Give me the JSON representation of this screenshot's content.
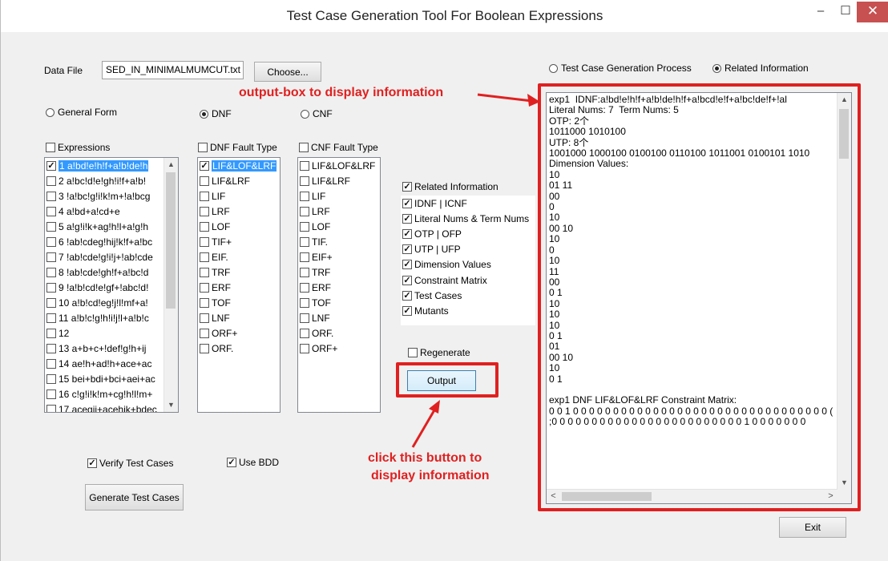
{
  "window": {
    "title": "Test Case Generation Tool  For Boolean Expressions",
    "minimize": "–",
    "maximize": "☐",
    "close": "✕"
  },
  "data_file": {
    "label": "Data File",
    "value": "SED_IN_MINIMALMUMCUT.txt",
    "choose": "Choose..."
  },
  "view_mode": {
    "process": "Test Case Generation Process",
    "related": "Related Information",
    "selected": "related"
  },
  "form": {
    "general": "General Form",
    "dnf": "DNF",
    "cnf": "CNF",
    "selected": "dnf"
  },
  "expressions": {
    "header": "Expressions",
    "items": [
      {
        "label": "1 a!bd!e!h!f+a!b!de!h",
        "checked": true,
        "selected": true
      },
      {
        "label": "2 a!bc!d!e!gh!i!f+a!b!",
        "checked": false
      },
      {
        "label": "3 !a!bc!g!i!k!m+!a!bcg",
        "checked": false
      },
      {
        "label": "4 a!bd+a!cd+e",
        "checked": false
      },
      {
        "label": "5 a!g!i!k+ag!h!l+a!g!h",
        "checked": false
      },
      {
        "label": "6 !ab!cdeg!hij!k!f+a!bc",
        "checked": false
      },
      {
        "label": "7 !ab!cde!g!i!j+!ab!cde",
        "checked": false
      },
      {
        "label": "8 !ab!cde!gh!f+a!bc!d",
        "checked": false
      },
      {
        "label": "9 !a!b!cd!e!gf+!abc!d!",
        "checked": false
      },
      {
        "label": "10 a!b!cd!eg!j!l!mf+a!",
        "checked": false
      },
      {
        "label": "11 a!b!c!g!h!i!j!l+a!b!c",
        "checked": false
      },
      {
        "label": "12",
        "checked": false
      },
      {
        "label": "13 a+b+c+!def!g!h+ij",
        "checked": false
      },
      {
        "label": "14 ae!h+ad!h+ace+ac",
        "checked": false
      },
      {
        "label": "15 bei+bdi+bci+aei+ac",
        "checked": false
      },
      {
        "label": "16 c!g!i!k!m+cg!h!l!m+",
        "checked": false
      },
      {
        "label": "17 acegij+acehik+bdec",
        "checked": false
      }
    ]
  },
  "dnf_fault": {
    "header": "DNF Fault Type",
    "items": [
      {
        "label": "LIF&LOF&LRF",
        "checked": true,
        "selected": true
      },
      {
        "label": "LIF&LRF"
      },
      {
        "label": "LIF"
      },
      {
        "label": "LRF"
      },
      {
        "label": "LOF"
      },
      {
        "label": "TIF+"
      },
      {
        "label": "EIF."
      },
      {
        "label": "TRF"
      },
      {
        "label": "ERF"
      },
      {
        "label": "TOF"
      },
      {
        "label": "LNF"
      },
      {
        "label": "ORF+"
      },
      {
        "label": "ORF."
      }
    ]
  },
  "cnf_fault": {
    "header": "CNF Fault Type",
    "items": [
      {
        "label": "LIF&LOF&LRF"
      },
      {
        "label": "LIF&LRF"
      },
      {
        "label": "LIF"
      },
      {
        "label": "LRF"
      },
      {
        "label": "LOF"
      },
      {
        "label": "TIF."
      },
      {
        "label": "EIF+"
      },
      {
        "label": "TRF"
      },
      {
        "label": "ERF"
      },
      {
        "label": "TOF"
      },
      {
        "label": "LNF"
      },
      {
        "label": "ORF."
      },
      {
        "label": "ORF+"
      }
    ]
  },
  "related_info": {
    "header": "Related Information",
    "items": [
      {
        "label": "IDNF | ICNF"
      },
      {
        "label": "Literal Nums & Term Nums"
      },
      {
        "label": "OTP | OFP"
      },
      {
        "label": "UTP | UFP"
      },
      {
        "label": "Dimension Values"
      },
      {
        "label": "Constraint Matrix"
      },
      {
        "label": "Test Cases"
      },
      {
        "label": "Mutants"
      }
    ]
  },
  "regenerate": "Regenerate",
  "output_button": "Output",
  "verify": "Verify Test Cases",
  "use_bdd": "Use BDD",
  "generate": "Generate Test Cases",
  "exit": "Exit",
  "output_lines": [
    "exp1  IDNF:a!bd!e!h!f+a!b!de!h!f+a!bcd!e!f+a!bc!de!f+!al",
    "Literal Nums: 7  Term Nums: 5",
    "OTP: 2个",
    "1011000 1010100",
    "UTP: 8个",
    "1001000 1000100 0100100 0110100 1011001 0100101 1010",
    "Dimension Values:",
    "10",
    "01 11",
    "00",
    "0",
    "10",
    "00 10",
    "10",
    "0",
    "10",
    "11",
    "00",
    "0 1",
    "10",
    "10",
    "10",
    "0 1",
    "01",
    "00 10",
    "10",
    "0 1",
    "",
    "exp1 DNF LIF&LOF&LRF Constraint Matrix:",
    "0 0 1 0 0 0 0 0 0 0 0 0 0 0 0 0 0 0 0 0 0 0 0 0 0 0 0 0 0 0 0 0 0 0 0 (",
    ";0 0 0 0 0 0 0 0 0 0 0 0 0 0 0 0 0 0 0 0 0 0 0 0 1 0 0 0 0 0 0 0"
  ],
  "annotations": {
    "top": "output-box to display information",
    "bottom_line1": "click this button to",
    "bottom_line2": "display information"
  }
}
